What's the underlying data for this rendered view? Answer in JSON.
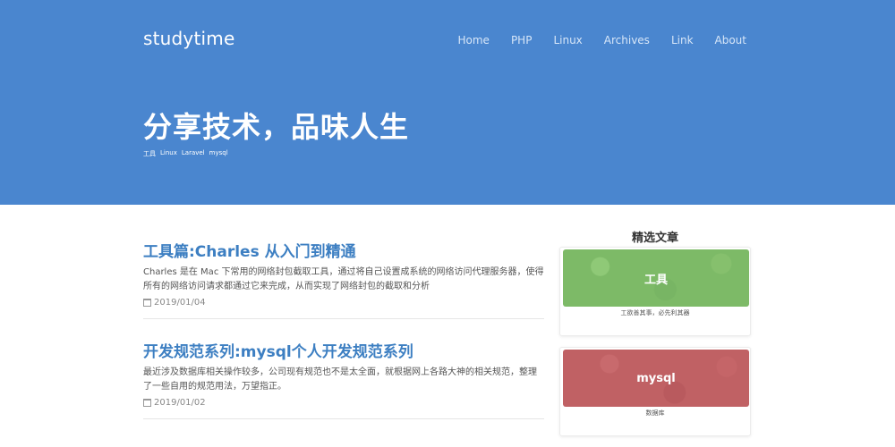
{
  "header": {
    "brand": "studytime",
    "nav": [
      "Home",
      "PHP",
      "Linux",
      "Archives",
      "Link",
      "About"
    ],
    "title": "分享技术，品味人生",
    "tags": [
      "工具",
      "Linux",
      "Laravel",
      "mysql"
    ]
  },
  "posts": [
    {
      "title": "工具篇:Charles 从入门到精通",
      "excerpt": "Charles 是在 Mac 下常用的网络封包截取工具，通过将自己设置成系统的网络访问代理服务器，使得所有的网络访问请求都通过它来完成，从而实现了网络封包的截取和分析",
      "date": "2019/01/04"
    },
    {
      "title": "开发规范系列:mysql个人开发规范系列",
      "excerpt": "最近涉及数据库相关操作较多，公司现有规范也不是太全面，就根据网上各路大神的相关规范，整理了一些自用的规范用法，万望指正。",
      "date": "2019/01/02"
    }
  ],
  "sidebar": {
    "title": "精选文章",
    "cards": [
      {
        "label": "工具",
        "caption": "工欲善其事，必先利其器",
        "color": "#7dba67"
      },
      {
        "label": "mysql",
        "caption": "数据库",
        "color": "#c06164"
      }
    ]
  }
}
